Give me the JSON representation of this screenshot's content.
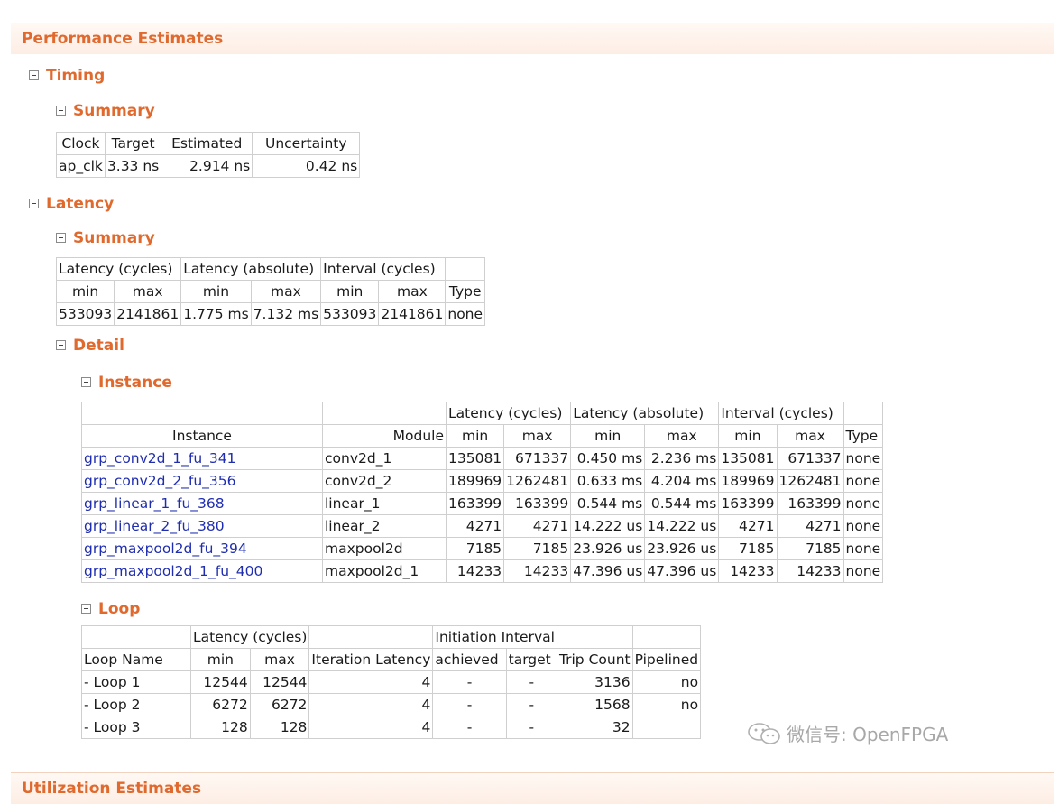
{
  "performance_estimates": "Performance Estimates",
  "timing": {
    "heading": "Timing",
    "summary_heading": "Summary",
    "headers": [
      "Clock",
      "Target",
      "Estimated",
      "Uncertainty"
    ],
    "row": [
      "ap_clk",
      "3.33 ns",
      "2.914 ns",
      "0.42 ns"
    ]
  },
  "latency": {
    "heading": "Latency",
    "summary_heading": "Summary",
    "group_headers": [
      "Latency (cycles)",
      "Latency (absolute)",
      "Interval (cycles)"
    ],
    "sub_headers": [
      "min",
      "max",
      "min",
      "max",
      "min",
      "max",
      "Type"
    ],
    "row": [
      "533093",
      "2141861",
      "1.775 ms",
      "7.132 ms",
      "533093",
      "2141861",
      "none"
    ],
    "detail_heading": "Detail",
    "instance": {
      "heading": "Instance",
      "group_headers": [
        "Latency (cycles)",
        "Latency (absolute)",
        "Interval (cycles)"
      ],
      "headers": [
        "Instance",
        "Module",
        "min",
        "max",
        "min",
        "max",
        "min",
        "max",
        "Type"
      ],
      "rows": [
        [
          "grp_conv2d_1_fu_341",
          "conv2d_1",
          "135081",
          "671337",
          "0.450 ms",
          "2.236 ms",
          "135081",
          "671337",
          "none"
        ],
        [
          "grp_conv2d_2_fu_356",
          "conv2d_2",
          "189969",
          "1262481",
          "0.633 ms",
          "4.204 ms",
          "189969",
          "1262481",
          "none"
        ],
        [
          "grp_linear_1_fu_368",
          "linear_1",
          "163399",
          "163399",
          "0.544 ms",
          "0.544 ms",
          "163399",
          "163399",
          "none"
        ],
        [
          "grp_linear_2_fu_380",
          "linear_2",
          "4271",
          "4271",
          "14.222 us",
          "14.222 us",
          "4271",
          "4271",
          "none"
        ],
        [
          "grp_maxpool2d_fu_394",
          "maxpool2d",
          "7185",
          "7185",
          "23.926 us",
          "23.926 us",
          "7185",
          "7185",
          "none"
        ],
        [
          "grp_maxpool2d_1_fu_400",
          "maxpool2d_1",
          "14233",
          "14233",
          "47.396 us",
          "47.396 us",
          "14233",
          "14233",
          "none"
        ]
      ]
    },
    "loop": {
      "heading": "Loop",
      "group_headers": [
        "Latency (cycles)",
        "Initiation Interval"
      ],
      "headers": [
        "Loop Name",
        "min",
        "max",
        "Iteration Latency",
        "achieved",
        "target",
        "Trip Count",
        "Pipelined"
      ],
      "rows": [
        [
          "- Loop 1",
          "12544",
          "12544",
          "4",
          "-",
          "-",
          "3136",
          "no"
        ],
        [
          "- Loop 2",
          "6272",
          "6272",
          "4",
          "-",
          "-",
          "1568",
          "no"
        ],
        [
          "- Loop 3",
          "128",
          "128",
          "4",
          "-",
          "-",
          "32",
          ""
        ]
      ]
    }
  },
  "utilization_estimates": "Utilization Estimates",
  "watermark": "微信号: OpenFPGA",
  "icons": {
    "toggle": "collapse-toggle-icon",
    "wechat": "wechat-icon"
  },
  "colors": {
    "heading": "#e0692e",
    "link": "#1f2db0",
    "border": "#cfcfcf"
  }
}
